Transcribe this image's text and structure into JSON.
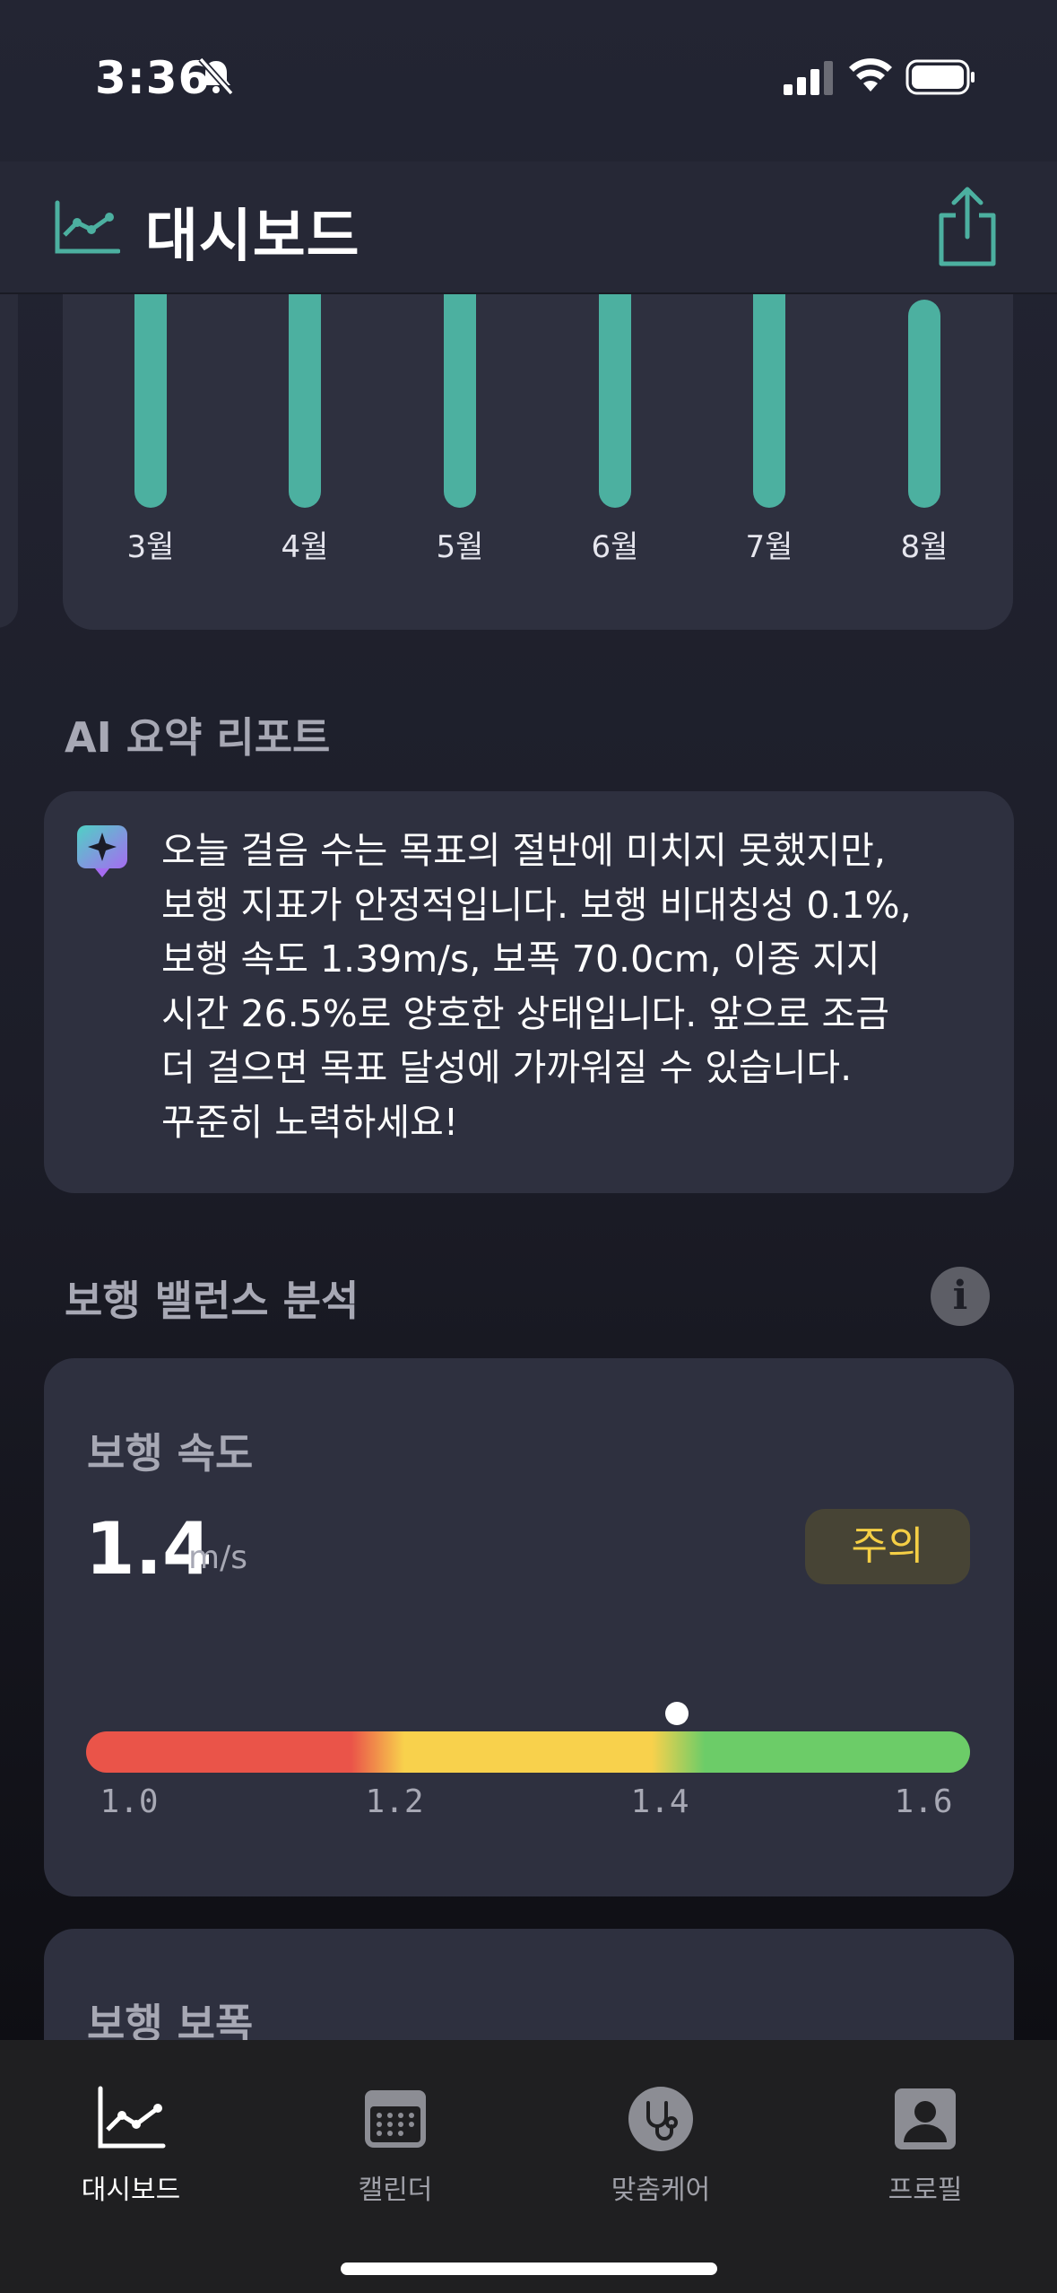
{
  "status_bar": {
    "time": "3:36"
  },
  "header": {
    "title": "대시보드"
  },
  "monthly_chart": {
    "months": [
      "3월",
      "4월",
      "5월",
      "6월",
      "7월",
      "8월"
    ]
  },
  "ai_report": {
    "section_title": "AI 요약 리포트",
    "text": "오늘 걸음 수는 목표의 절반에 미치지 못했지만,\n보행 지표가 안정적입니다. 보행 비대칭성 0.1%,\n보행 속도 1.39m/s, 보폭 70.0cm, 이중 지지\n시간 26.5%로 양호한 상태입니다. 앞으로 조금\n더 걸으면 목표 달성에 가까워질 수 있습니다.\n꾸준히 노력하세요!"
  },
  "balance": {
    "section_title": "보행 밸런스 분석",
    "info_glyph": "i",
    "speed": {
      "label": "보행 속도",
      "value": "1.4",
      "unit": "m/s",
      "status": "주의",
      "status_color": "#f5cf45",
      "scale_min": 1.0,
      "scale_max": 1.6,
      "marker_value": 1.4,
      "ticks": [
        "1.0",
        "1.2",
        "1.4",
        "1.6"
      ]
    },
    "next_metric_label": "보행 보폭"
  },
  "tabs": [
    {
      "label": "대시보드",
      "icon": "chart-line-icon",
      "active": true
    },
    {
      "label": "캘린더",
      "icon": "calendar-icon",
      "active": false
    },
    {
      "label": "맞춤케어",
      "icon": "stethoscope-icon",
      "active": false
    },
    {
      "label": "프로필",
      "icon": "person-icon",
      "active": false
    }
  ],
  "colors": {
    "accent": "#4cb0a0",
    "background": "#1c1d28",
    "card": "#2e303f"
  }
}
